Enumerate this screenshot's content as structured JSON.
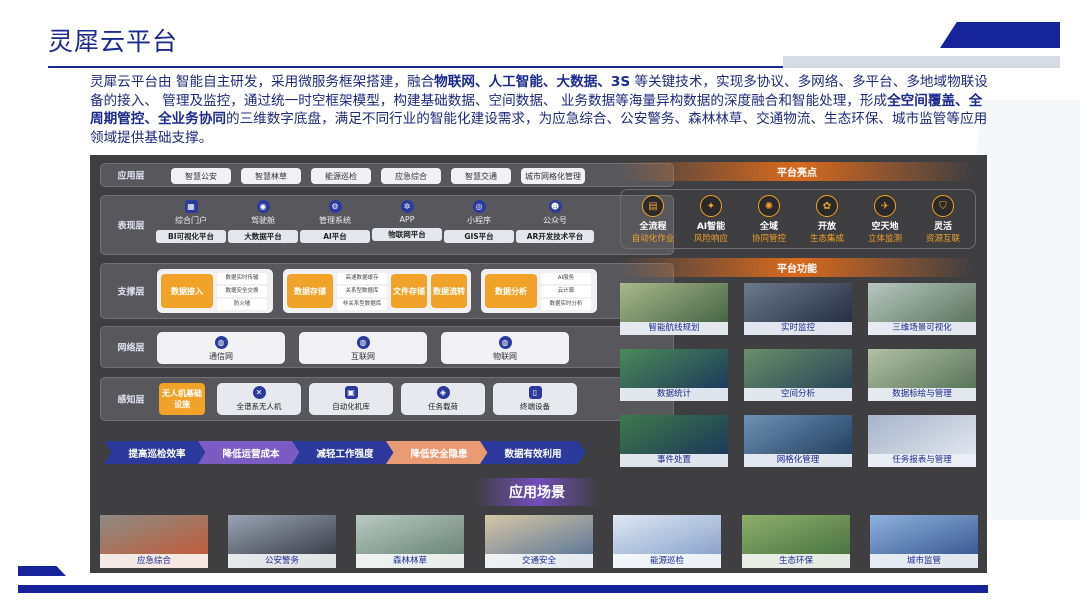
{
  "title": "灵犀云平台",
  "intro": {
    "p1": "灵犀云平台由 智能自主研发，采用微服务框架搭建，融合",
    "b1": "物联网、人工智能、大数据、3S",
    "p2": " 等关键技术，实现多协议、多网络、多平台、多地域物联设备的接入、 管理及监控，通过统一时空框架模型，构建基础数据、空间数据、 业务数据等海量异构数据的深度融合和智能处理，形成",
    "b2": "全空间覆盖、全周期管控、全业务协同",
    "p3": "的三维数字底盘，满足不同行业的智能化建设需求，为应急综合、公安警务、森林林草、交通物流、生态环保、城市监管等应用领域提供基础支撑。"
  },
  "layers": {
    "application": {
      "label": "应用层",
      "items": [
        "智慧公安",
        "智慧林草",
        "能源巡检",
        "应急综合",
        "智慧交通",
        "城市网格化管理"
      ]
    },
    "presentation": {
      "label": "表现层",
      "items": [
        {
          "label": "综合门户",
          "platform": "BI可视化平台",
          "icon": "portal-icon",
          "glyph": "▦"
        },
        {
          "label": "驾驶舱",
          "platform": "大数据平台",
          "icon": "cockpit-icon",
          "glyph": "◉"
        },
        {
          "label": "管理系统",
          "platform": "AI平台",
          "icon": "management-icon",
          "glyph": "⚙"
        },
        {
          "label": "APP",
          "platform": "物联网平台",
          "icon": "app-icon",
          "glyph": "✲"
        },
        {
          "label": "小程序",
          "platform": "GIS平台",
          "icon": "mini-program-icon",
          "glyph": "◎"
        },
        {
          "label": "公众号",
          "platform": "AR开发技术平台",
          "icon": "wechat-icon",
          "glyph": "☻"
        }
      ]
    },
    "support": {
      "label": "支撑层",
      "access": {
        "main": "数据接入",
        "subs": [
          "数据实时传输",
          "数据安全交换",
          "防火墙"
        ]
      },
      "storage": {
        "main": "数据存储",
        "subs": [
          "高速数据缓存",
          "关系型数据库",
          "非关系型数据库"
        ],
        "file": "文件存储",
        "bus": "数据流转"
      },
      "analysis": {
        "main": "数据分析",
        "subs": [
          "AI服务",
          "云计算",
          "数据实时分析"
        ]
      }
    },
    "network": {
      "label": "网络层",
      "items": [
        {
          "label": "通信网",
          "icon": "communication-network-icon",
          "glyph": "◍"
        },
        {
          "label": "互联网",
          "icon": "internet-icon",
          "glyph": "◍"
        },
        {
          "label": "物联网",
          "icon": "iot-network-icon",
          "glyph": "◍"
        }
      ]
    },
    "perception": {
      "label": "感知层",
      "highlight": "无人机基础设施",
      "items": [
        {
          "label": "全谱系无人机",
          "icon": "drone-icon",
          "glyph": "✕"
        },
        {
          "label": "自动化机库",
          "icon": "hangar-icon",
          "glyph": "▣"
        },
        {
          "label": "任务载荷",
          "icon": "payload-icon",
          "glyph": "◈"
        },
        {
          "label": "终端设备",
          "icon": "terminal-icon",
          "glyph": "▯"
        }
      ]
    }
  },
  "benefits": [
    {
      "label": "提高巡检效率",
      "color": "#2b3a9c"
    },
    {
      "label": "降低运营成本",
      "color": "#7a5cc2"
    },
    {
      "label": "减轻工作强度",
      "color": "#2b3a9c"
    },
    {
      "label": "降低安全隐患",
      "color": "#e89a72"
    },
    {
      "label": "数据有效利用",
      "color": "#2b3a9c"
    }
  ],
  "scenarios": {
    "title": "应用场景",
    "items": [
      {
        "label": "应急综合",
        "palette": [
          "#c9562e",
          "#8d8a86"
        ]
      },
      {
        "label": "公安警务",
        "palette": [
          "#2a2d36",
          "#9aa4b4"
        ]
      },
      {
        "label": "森林林草",
        "palette": [
          "#5d7a6b",
          "#b9c9c1"
        ]
      },
      {
        "label": "交通安全",
        "palette": [
          "#4a6b94",
          "#d7c7a6"
        ]
      },
      {
        "label": "能源巡检",
        "palette": [
          "#7c98c4",
          "#dfe7f2"
        ]
      },
      {
        "label": "生态环保",
        "palette": [
          "#3e6a3a",
          "#8fae6b"
        ]
      },
      {
        "label": "城市监管",
        "palette": [
          "#2e4a86",
          "#8fb2dd"
        ]
      }
    ]
  },
  "highlights": {
    "title": "平台亮点",
    "items": [
      {
        "t1": "全流程",
        "t2": "自动化作业",
        "icon": "workflow-icon",
        "glyph": "▤"
      },
      {
        "t1": "AI智能",
        "t2": "风险响应",
        "icon": "ai-icon",
        "glyph": "✦"
      },
      {
        "t1": "全域",
        "t2": "协同管控",
        "icon": "global-icon",
        "glyph": "✺"
      },
      {
        "t1": "开放",
        "t2": "生态集成",
        "icon": "open-icon",
        "glyph": "✿"
      },
      {
        "t1": "空天地",
        "t2": "立体监测",
        "icon": "space-air-ground-icon",
        "glyph": "✈"
      },
      {
        "t1": "灵活",
        "t2": "资源互联",
        "icon": "shield-icon",
        "glyph": "⛉"
      }
    ]
  },
  "functions": {
    "title": "平台功能",
    "items": [
      {
        "label": "智能航线规划",
        "palette": [
          "#3a5a3b",
          "#a9b88d"
        ]
      },
      {
        "label": "实时监控",
        "palette": [
          "#1b2538",
          "#6d7a8c"
        ]
      },
      {
        "label": "三维场景可视化",
        "palette": [
          "#4f6b54",
          "#b8c7c0"
        ]
      },
      {
        "label": "数据统计",
        "palette": [
          "#19305a",
          "#4b8a58"
        ]
      },
      {
        "label": "空间分析",
        "palette": [
          "#213a54",
          "#6a8f6a"
        ]
      },
      {
        "label": "数据标绘与管理",
        "palette": [
          "#4d6b4e",
          "#b2c0a6"
        ]
      },
      {
        "label": "事件处置",
        "palette": [
          "#19305a",
          "#3e7a4a"
        ]
      },
      {
        "label": "网格化管理",
        "palette": [
          "#1b3554",
          "#6e92b4"
        ]
      },
      {
        "label": "任务报表与管理",
        "palette": [
          "#e8ecf4",
          "#a6b3c8"
        ]
      }
    ]
  }
}
